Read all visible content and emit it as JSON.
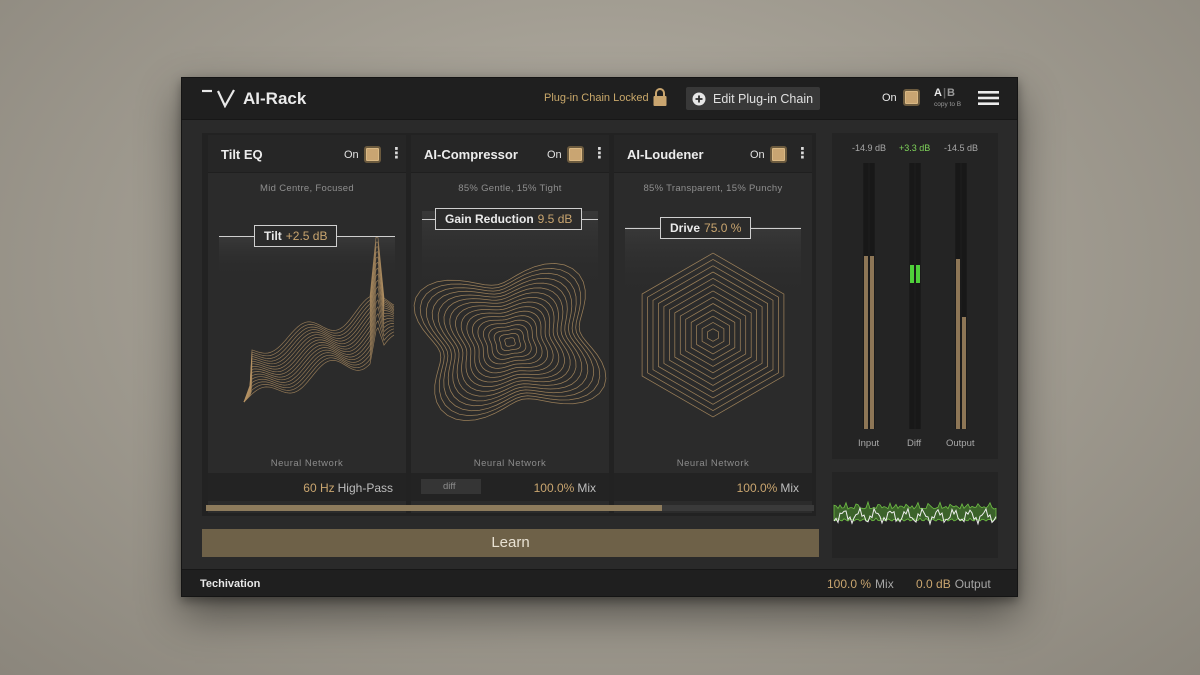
{
  "app": {
    "title": "AI-Rack",
    "chain_lock_text": "Plug-in Chain Locked",
    "edit_chain_label": "Edit Plug-in Chain",
    "power_label": "On",
    "ab": {
      "a": "A",
      "separator": "|",
      "b": "B",
      "copy_label": "copy to B"
    }
  },
  "modules": [
    {
      "title": "Tilt EQ",
      "on_label": "On",
      "subtitle": "Mid Centre, Focused",
      "param_name": "Tilt",
      "param_value": "+2.5 dB",
      "footer_label": "Neural Network",
      "bottom_value": "60 Hz",
      "bottom_unit": "High-Pass"
    },
    {
      "title": "AI-Compressor",
      "on_label": "On",
      "subtitle": "85% Gentle, 15% Tight",
      "param_name": "Gain Reduction",
      "param_value": "9.5 dB",
      "footer_label": "Neural Network",
      "chip_label": "diff",
      "bottom_value": "100.0%",
      "bottom_unit": "Mix"
    },
    {
      "title": "AI-Loudener",
      "on_label": "On",
      "subtitle": "85% Transparent, 15% Punchy",
      "param_name": "Drive",
      "param_value": "75.0 %",
      "footer_label": "Neural Network",
      "bottom_value": "100.0%",
      "bottom_unit": "Mix"
    }
  ],
  "learn_progress": 0.75,
  "learn_label": "Learn",
  "meters": {
    "input": {
      "label": "Input",
      "readout": "-14.9 dB",
      "level_left": 0.65,
      "level_right": 0.65
    },
    "diff": {
      "label": "Diff",
      "readout": "+3.3 dB",
      "level": 0.55
    },
    "output": {
      "label": "Output",
      "readout": "-14.5 dB",
      "level_left": 0.64,
      "level_right": 0.42
    },
    "colors": {
      "bar": "#8d7656",
      "diff": "#4fcf3a"
    }
  },
  "footer": {
    "brand": "Techivation",
    "mix_value": "100.0 %",
    "mix_unit": "Mix",
    "output_value": "0.0 dB",
    "output_unit": "Output"
  },
  "colors": {
    "accent": "#c9a56f",
    "learn": "#6e6148"
  }
}
